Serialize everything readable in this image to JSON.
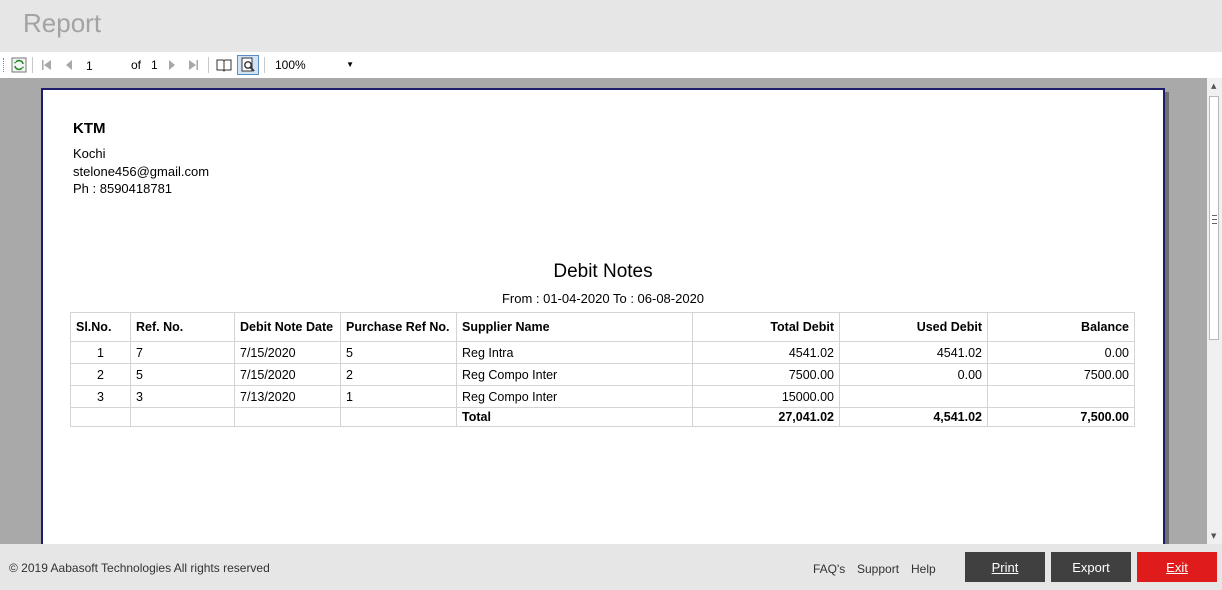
{
  "window": {
    "title": "Report"
  },
  "toolbar": {
    "current_page": "1",
    "of_label": "of",
    "total_pages": "1",
    "zoom": "100%"
  },
  "report": {
    "company": "KTM",
    "city": "Kochi",
    "email": "stelone456@gmail.com",
    "phone": "Ph : 8590418781",
    "title": "Debit Notes",
    "period": "From : 01-04-2020 To : 06-08-2020",
    "columns": [
      "Sl.No.",
      "Ref. No.",
      "Debit Note Date",
      "Purchase Ref No.",
      "Supplier Name",
      "Total Debit",
      "Used Debit",
      "Balance"
    ],
    "rows": [
      {
        "sl": "1",
        "ref": "7",
        "date": "7/15/2020",
        "purchase_ref": "5",
        "supplier": "Reg Intra",
        "total": "4541.02",
        "used": "4541.02",
        "balance": "0.00"
      },
      {
        "sl": "2",
        "ref": "5",
        "date": "7/15/2020",
        "purchase_ref": "2",
        "supplier": "Reg Compo Inter",
        "total": "7500.00",
        "used": "0.00",
        "balance": "7500.00"
      },
      {
        "sl": "3",
        "ref": "3",
        "date": "7/13/2020",
        "purchase_ref": "1",
        "supplier": "Reg Compo Inter",
        "total": "15000.00",
        "used": "",
        "balance": ""
      }
    ],
    "totals": {
      "label": "Total",
      "total": "27,041.02",
      "used": "4,541.02",
      "balance": "7,500.00"
    }
  },
  "footer": {
    "copyright": "© 2019 Aabasoft Technologies All rights reserved",
    "links": [
      "FAQ's",
      "Support",
      "Help"
    ],
    "print_label": "Print",
    "export_label": "Export",
    "exit_label": "Exit"
  },
  "colors": {
    "button_dark": "#404040",
    "button_exit": "#e01b1b",
    "paper_border": "#1d1d6b"
  }
}
